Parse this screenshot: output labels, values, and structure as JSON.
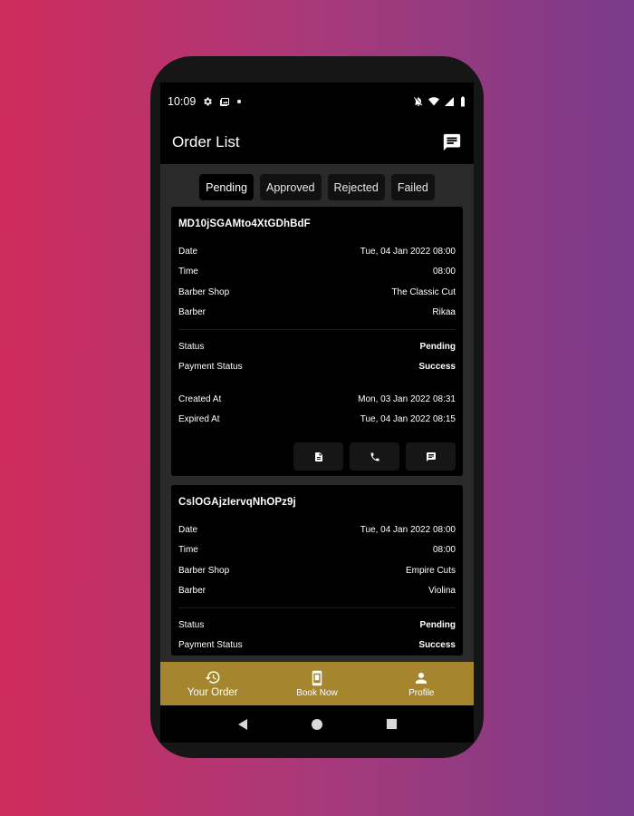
{
  "status_bar": {
    "time": "10:09",
    "icons_left": [
      "settings-icon",
      "photo-icon",
      "dot-icon"
    ],
    "icons_right": [
      "mute-icon",
      "wifi-icon",
      "signal-icon",
      "battery-icon"
    ]
  },
  "app_bar": {
    "title": "Order List",
    "action_icon": "chat-icon"
  },
  "tabs": [
    {
      "label": "Pending",
      "active": true
    },
    {
      "label": "Approved",
      "active": false
    },
    {
      "label": "Rejected",
      "active": false
    },
    {
      "label": "Failed",
      "active": false
    }
  ],
  "orders": [
    {
      "id": "MD10jSGAMto4XtGDhBdF",
      "fields": {
        "date_label": "Date",
        "date": "Tue, 04 Jan 2022 08:00",
        "time_label": "Time",
        "time": "08:00",
        "shop_label": "Barber Shop",
        "shop": "The Classic Cut",
        "barber_label": "Barber",
        "barber": "Rikaa",
        "status_label": "Status",
        "status": "Pending",
        "payment_label": "Payment Status",
        "payment": "Success",
        "created_label": "Created At",
        "created": "Mon, 03 Jan 2022 08:31",
        "expired_label": "Expired At",
        "expired": "Tue, 04 Jan 2022 08:15"
      },
      "actions": [
        "receipt-icon",
        "phone-icon",
        "chat-icon"
      ]
    },
    {
      "id": "CslOGAjzIervqNhOPz9j",
      "fields": {
        "date_label": "Date",
        "date": "Tue, 04 Jan 2022 08:00",
        "time_label": "Time",
        "time": "08:00",
        "shop_label": "Barber Shop",
        "shop": "Empire Cuts",
        "barber_label": "Barber",
        "barber": "Violina",
        "status_label": "Status",
        "status": "Pending",
        "payment_label": "Payment Status",
        "payment": "Success"
      }
    }
  ],
  "bottom_nav": [
    {
      "label": "Your Order",
      "icon": "history-icon",
      "active": true
    },
    {
      "label": "Book Now",
      "icon": "phone-book-icon",
      "active": false
    },
    {
      "label": "Profile",
      "icon": "person-icon",
      "active": false
    }
  ],
  "colors": {
    "accent": "#a5862e",
    "background": "#2a2a2a",
    "card": "#000000"
  }
}
